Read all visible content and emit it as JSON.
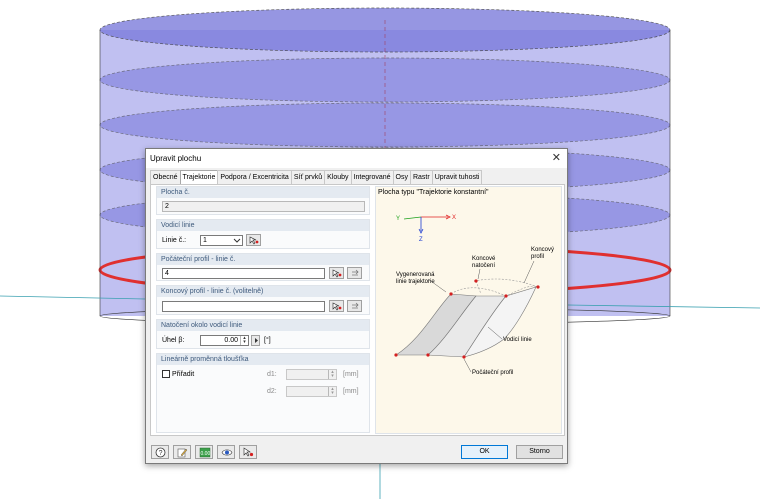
{
  "dialog": {
    "title": "Upravit plochu",
    "close_glyph": "✕",
    "tabs": [
      {
        "label": "Obecné"
      },
      {
        "label": "Trajektorie"
      },
      {
        "label": "Podpora / Excentricita"
      },
      {
        "label": "Síť prvků"
      },
      {
        "label": "Klouby"
      },
      {
        "label": "Integrované"
      },
      {
        "label": "Osy"
      },
      {
        "label": "Rastr"
      },
      {
        "label": "Upravit tuhosti"
      }
    ],
    "active_tab": "Trajektorie"
  },
  "plocha": {
    "header": "Plocha č.",
    "value": "2"
  },
  "vodici": {
    "header": "Vodicí linie",
    "label": "Linie č.:",
    "value": "1"
  },
  "pocatecni": {
    "header": "Počáteční profil - linie č.",
    "value": "4"
  },
  "koncovy": {
    "header": "Koncový profil - linie č. (volitelně)",
    "value": ""
  },
  "natoceni": {
    "header": "Natočení okolo vodicí linie",
    "label": "Úhel β:",
    "value": "0.00",
    "unit": "[°]"
  },
  "tloustka": {
    "header": "Lineárně proměnná tloušťka",
    "checkbox_label": "Přiřadit",
    "checked": false,
    "d1_label": "d1:",
    "d2_label": "d2:",
    "d1_value": "",
    "d2_value": "",
    "unit": "[mm]"
  },
  "diagram": {
    "title": "Plocha typu \"Trajektorie konstantní\"",
    "axis_x": "X",
    "axis_y": "Y",
    "axis_z": "Z",
    "label_generated": [
      "Vygenerovaná",
      "linie trajektorie"
    ],
    "label_end_rotation": [
      "Koncové",
      "natočení"
    ],
    "label_end_profile": [
      "Koncový",
      "profil"
    ],
    "label_guide": "Vodicí linie",
    "label_start_profile": "Počáteční profil",
    "colors": {
      "x_axis": "#e02020",
      "y_axis": "#1aa01a",
      "z_axis": "#1a3ad0",
      "points": "#d42020"
    }
  },
  "buttons": {
    "ok": "OK",
    "cancel": "Storno"
  },
  "footer_icons": [
    "help-icon",
    "edit-icon",
    "units-icon",
    "view-icon",
    "pick-icon"
  ],
  "colors": {
    "cylinder_fill": "#6e6ee0",
    "ring_highlight": "#e03030",
    "group_header_text": "#3e5a7c",
    "ok_border": "#0078d7"
  }
}
